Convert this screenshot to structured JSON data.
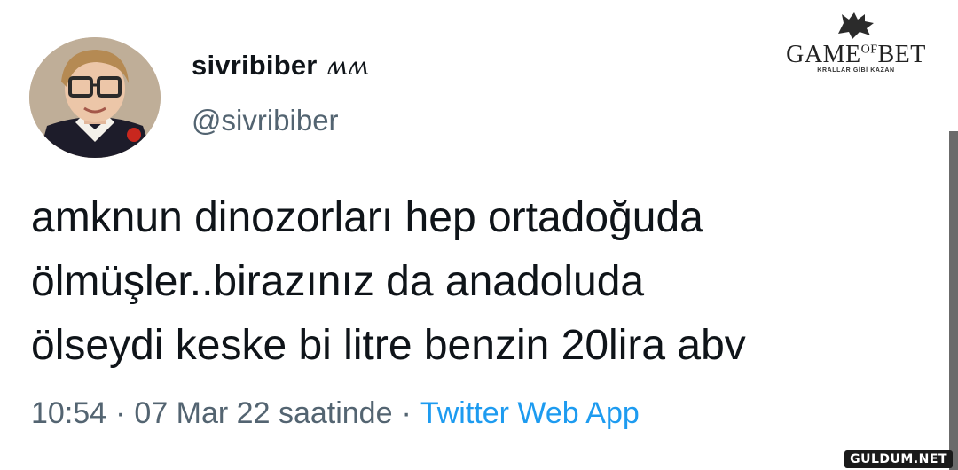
{
  "tweet": {
    "display_name": "sivribiber",
    "name_emoji": "ʍʍ",
    "handle": "@sivribiber",
    "text": "amknun dinozorları hep ortadoğuda\nölmüşler..birazınız da anadoluda\nölseydi keske bi litre benzin 20lira abv",
    "time": "10:54",
    "separator": "·",
    "date": "07 Mar 22 saatinde",
    "source": "Twitter Web App"
  },
  "logo": {
    "game": "GAME",
    "of": "OF",
    "bet": "BET",
    "tagline": "KRALLAR GİBİ KAZAN"
  },
  "watermark": "GULDUM.NET",
  "colors": {
    "text": "#0f1419",
    "secondary": "#536471",
    "link": "#1d9bf0"
  }
}
